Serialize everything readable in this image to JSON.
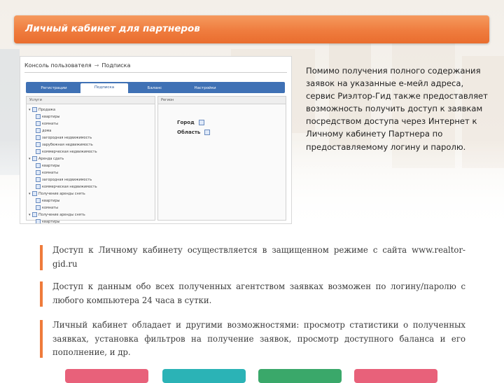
{
  "banner": {
    "title": "Личный кабинет для партнеров"
  },
  "screenshot": {
    "breadcrumb": {
      "root": "Консоль пользователя",
      "separator": "→",
      "current": "Подписка"
    },
    "tabs": [
      {
        "label": "Регистрации",
        "active": false
      },
      {
        "label": "Подписка",
        "active": true
      },
      {
        "label": "Баланс",
        "active": false
      },
      {
        "label": "Настройки",
        "active": false
      }
    ],
    "left_column_title": "Услуги",
    "right_column_title": "Регион",
    "tree": [
      {
        "level": 0,
        "label": "Продажа"
      },
      {
        "level": 1,
        "label": "квартиры"
      },
      {
        "level": 1,
        "label": "комнаты"
      },
      {
        "level": 1,
        "label": "дома"
      },
      {
        "level": 1,
        "label": "загородная недвижимость"
      },
      {
        "level": 1,
        "label": "зарубежная недвижимость"
      },
      {
        "level": 1,
        "label": "коммерческая недвижимость"
      },
      {
        "level": 0,
        "label": "Аренда сдать"
      },
      {
        "level": 1,
        "label": "квартиры"
      },
      {
        "level": 1,
        "label": "комнаты"
      },
      {
        "level": 1,
        "label": "загородная недвижимость"
      },
      {
        "level": 1,
        "label": "коммерческая недвижимость"
      },
      {
        "level": 0,
        "label": "Получение аренды снять"
      },
      {
        "level": 1,
        "label": "квартиры"
      },
      {
        "level": 1,
        "label": "комнаты"
      },
      {
        "level": 0,
        "label": "Получение аренды снять"
      },
      {
        "level": 1,
        "label": "квартиры"
      }
    ],
    "region_fields": [
      {
        "label": "Город"
      },
      {
        "label": "Область"
      }
    ]
  },
  "side_text": "Помимо получения полного содержания заявок на указанные е-мейл адреса, сервис Риэлтор-Гид также предоставляет возможность получить доступ к заявкам посредством доступа через Интернет к Личному кабинету Партнера по предоставляемому логину и паролю.",
  "bullets": [
    {
      "text": "Доступ к Личному кабинету осуществляется в защищенном режиме с сайта www.realtor-gid.ru"
    },
    {
      "text": "Доступ к данным обо всех полученных агентством заявках возможен по логину/паролю с любого компьютера 24 часа в сутки."
    },
    {
      "text": "Личный кабинет обладает и другими возможностями: просмотр статистики о полученных заявках, установка фильтров на получение заявок, просмотр доступного баланса и его пополнение, и др."
    }
  ],
  "colors": {
    "accent": "#ef7b3b",
    "tab_bar": "#3f71b5",
    "tiles": [
      "#e8617a",
      "#2bb3b6",
      "#3aa86a",
      "#e8617a"
    ]
  }
}
